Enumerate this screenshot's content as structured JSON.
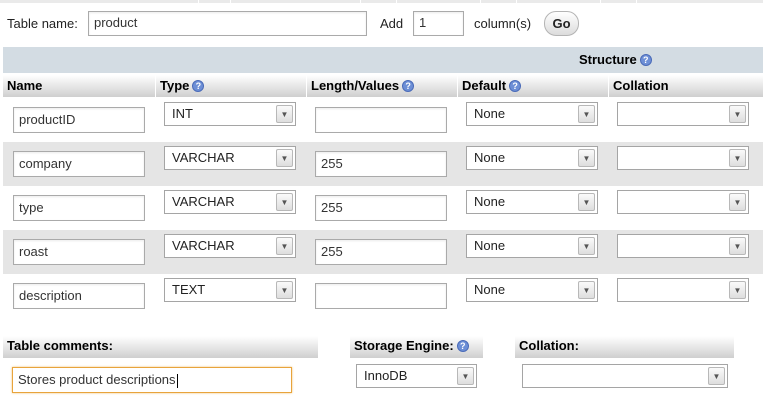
{
  "top": {
    "table_name_label": "Table name:",
    "table_name_value": "product",
    "add_label": "Add",
    "add_value": "1",
    "columns_label": "column(s)",
    "go_label": "Go"
  },
  "structure_label": "Structure",
  "headers": {
    "name": "Name",
    "type": "Type",
    "length": "Length/Values",
    "default": "Default",
    "collation": "Collation"
  },
  "rows": [
    {
      "name": "productID",
      "type": "INT",
      "length": "",
      "default": "None",
      "collation": ""
    },
    {
      "name": "company",
      "type": "VARCHAR",
      "length": "255",
      "default": "None",
      "collation": ""
    },
    {
      "name": "type",
      "type": "VARCHAR",
      "length": "255",
      "default": "None",
      "collation": ""
    },
    {
      "name": "roast",
      "type": "VARCHAR",
      "length": "255",
      "default": "None",
      "collation": ""
    },
    {
      "name": "description",
      "type": "TEXT",
      "length": "",
      "default": "None",
      "collation": ""
    }
  ],
  "bottom": {
    "table_comments_label": "Table comments:",
    "table_comments_value": "Stores product descriptions",
    "storage_engine_label": "Storage Engine:",
    "storage_engine_value": "InnoDB",
    "collation_label": "Collation:",
    "collation_value": ""
  },
  "icons": {
    "help": "help-icon",
    "dropdown": "chevron-down-icon"
  },
  "colors": {
    "structure_bar": "#d3dce3",
    "row_alt": "#e5e5e5",
    "help_icon": "#6d8fd6",
    "focus_border": "#e8a43c"
  }
}
